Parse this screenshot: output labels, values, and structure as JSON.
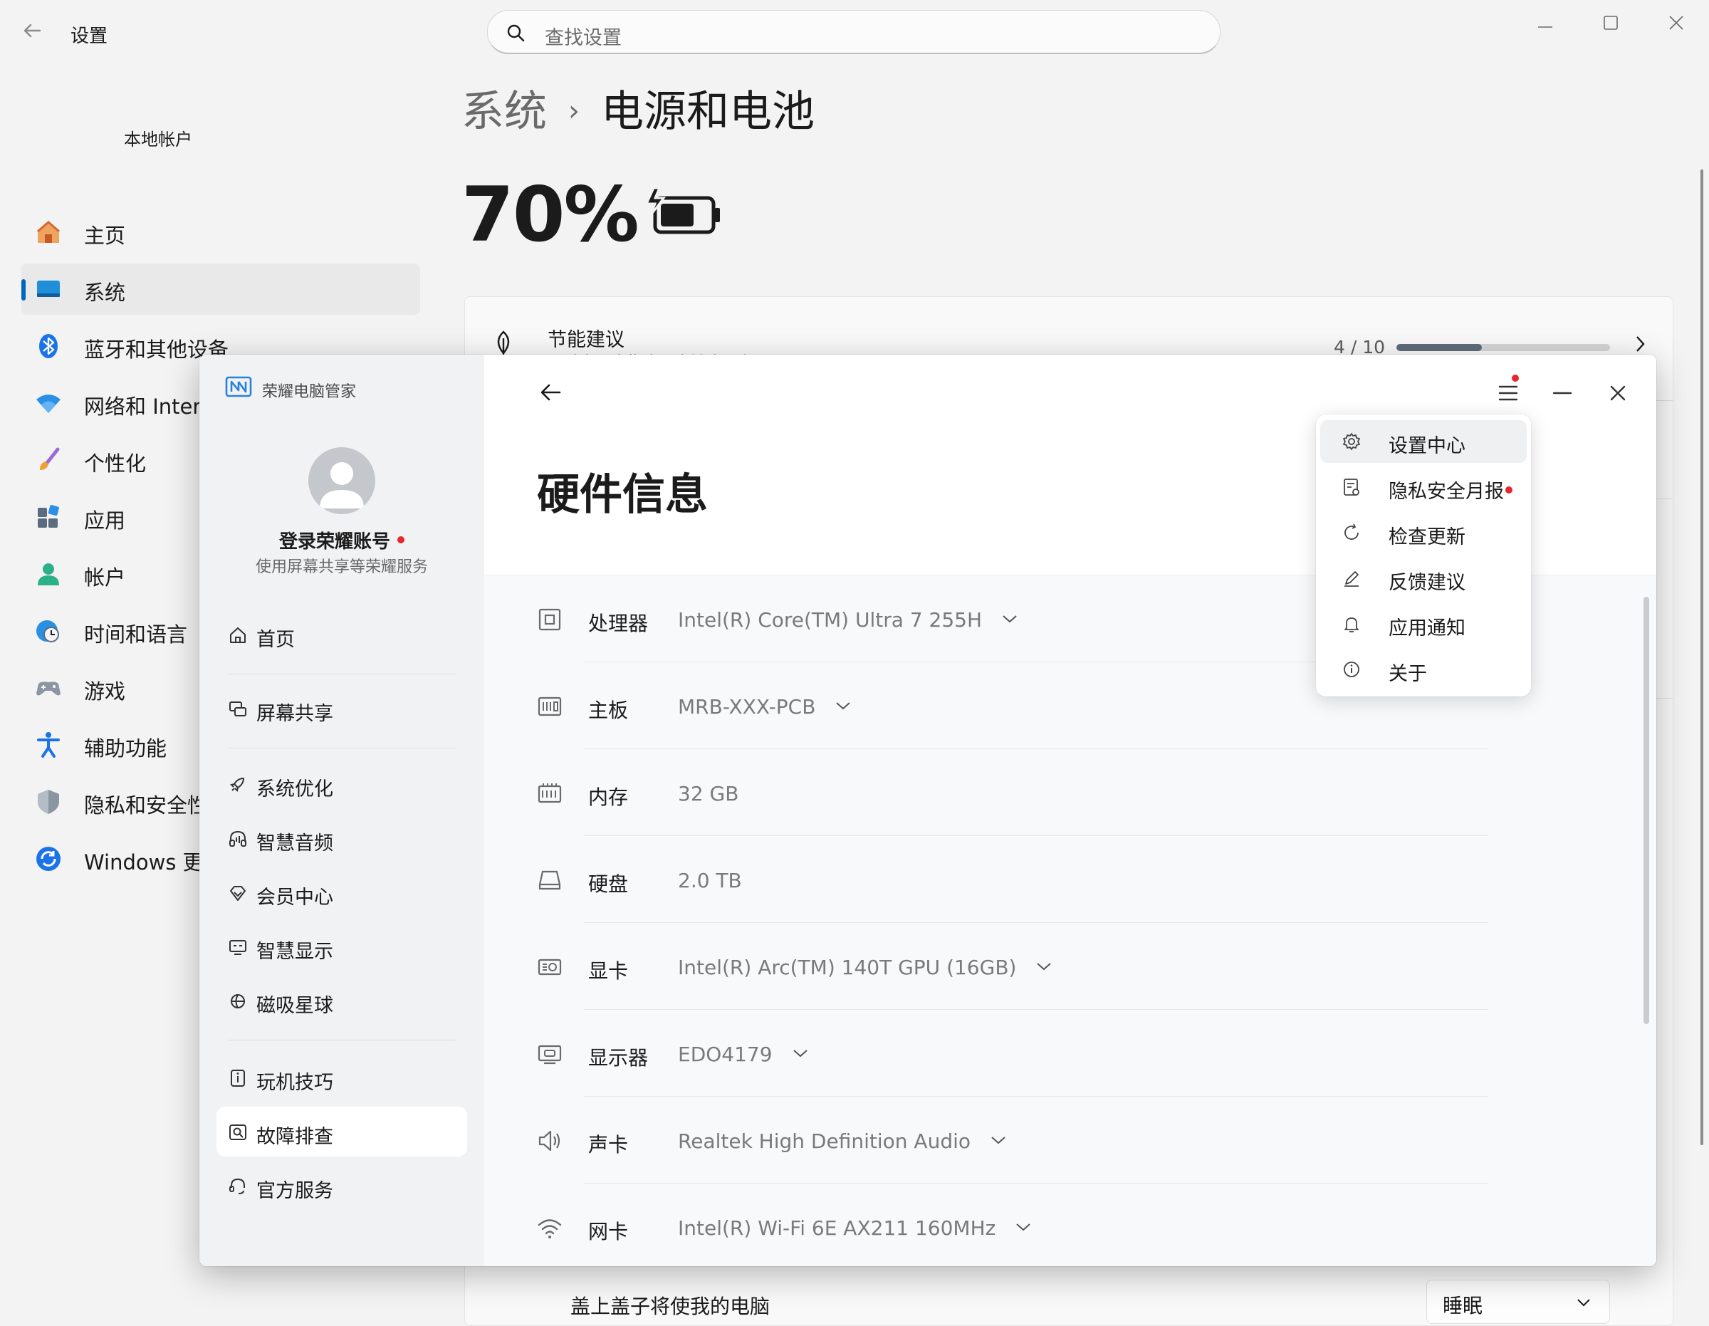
{
  "settings": {
    "app_title": "设置",
    "search_placeholder": "查找设置",
    "account_name": "本地帐户",
    "nav": [
      {
        "label": "主页",
        "icon": "home-icon"
      },
      {
        "label": "系统",
        "icon": "system-display-icon",
        "active": true
      },
      {
        "label": "蓝牙和其他设备",
        "icon": "bluetooth-icon"
      },
      {
        "label": "网络和 Intern",
        "icon": "wifi-icon"
      },
      {
        "label": "个性化",
        "icon": "paintbrush-icon"
      },
      {
        "label": "应用",
        "icon": "apps-icon"
      },
      {
        "label": "帐户",
        "icon": "account-icon"
      },
      {
        "label": "时间和语言",
        "icon": "clock-globe-icon"
      },
      {
        "label": "游戏",
        "icon": "gamepad-icon"
      },
      {
        "label": "辅助功能",
        "icon": "accessibility-icon"
      },
      {
        "label": "隐私和安全性",
        "icon": "shield-icon"
      },
      {
        "label": "Windows 更新",
        "icon": "windows-update-icon"
      }
    ],
    "breadcrumb_parent": "系统",
    "breadcrumb_current": "电源和电池",
    "battery_percent": "70%",
    "battery_level": 0.7,
    "eco_title": "节能建议",
    "eco_subtitle": "通过应用这些建议降低碳足迹",
    "eco_count": "4 / 10",
    "eco_progress": 0.4,
    "lid_label": "盖上盖子将使我的电脑",
    "lid_value": "睡眠"
  },
  "honor": {
    "app_name": "荣耀电脑管家",
    "login_title": "登录荣耀账号",
    "login_subtitle": "使用屏幕共享等荣耀服务",
    "nav": [
      {
        "label": "首页",
        "icon": "home-outline-icon"
      },
      {
        "label": "屏幕共享",
        "icon": "screen-share-icon"
      },
      {
        "label": "系统优化",
        "icon": "rocket-icon"
      },
      {
        "label": "智慧音频",
        "icon": "headphones-icon"
      },
      {
        "label": "会员中心",
        "icon": "diamond-icon"
      },
      {
        "label": "智慧显示",
        "icon": "display-icon"
      },
      {
        "label": "磁吸星球",
        "icon": "magnet-planet-icon"
      },
      {
        "label": "玩机技巧",
        "icon": "tips-icon"
      },
      {
        "label": "故障排查",
        "icon": "troubleshoot-icon",
        "active": true
      },
      {
        "label": "官方服务",
        "icon": "headset-icon"
      }
    ],
    "page_title": "硬件信息",
    "hardware": [
      {
        "label": "处理器",
        "value": "Intel(R) Core(TM) Ultra 7 255H",
        "expandable": true,
        "icon": "cpu-icon"
      },
      {
        "label": "主板",
        "value": "MRB-XXX-PCB",
        "expandable": true,
        "icon": "motherboard-icon"
      },
      {
        "label": "内存",
        "value": "32 GB",
        "expandable": false,
        "icon": "memory-icon"
      },
      {
        "label": "硬盘",
        "value": "2.0 TB",
        "expandable": false,
        "icon": "disk-icon"
      },
      {
        "label": "显卡",
        "value": "Intel(R) Arc(TM) 140T GPU (16GB)",
        "expandable": true,
        "icon": "gpu-icon"
      },
      {
        "label": "显示器",
        "value": "EDO4179",
        "expandable": true,
        "icon": "monitor-icon"
      },
      {
        "label": "声卡",
        "value": "Realtek High Definition Audio",
        "expandable": true,
        "icon": "speaker-icon"
      },
      {
        "label": "网卡",
        "value": "Intel(R) Wi-Fi 6E AX211 160MHz",
        "expandable": true,
        "icon": "wifi-outline-icon"
      }
    ],
    "menu": [
      {
        "label": "设置中心",
        "icon": "gear-icon",
        "hover": true
      },
      {
        "label": "隐私安全月报",
        "icon": "report-icon",
        "badge": true
      },
      {
        "label": "检查更新",
        "icon": "refresh-icon"
      },
      {
        "label": "反馈建议",
        "icon": "pen-icon"
      },
      {
        "label": "应用通知",
        "icon": "bell-icon"
      },
      {
        "label": "关于",
        "icon": "info-icon"
      }
    ]
  },
  "colors": {
    "accent_blue": "#0067c0",
    "badge_red": "#e8262d",
    "honor_sidebar": "#f1f2f4"
  }
}
